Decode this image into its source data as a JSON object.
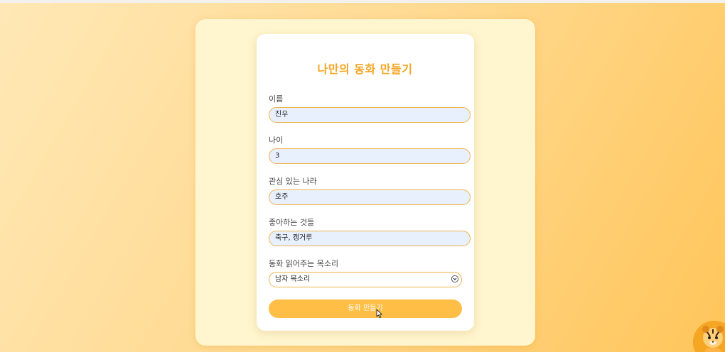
{
  "form": {
    "title": "나만의 동화 만들기",
    "name_label": "이름",
    "name_value": "진우",
    "age_label": "나이",
    "age_value": "3",
    "country_label": "관심 있는 나라",
    "country_value": "호주",
    "likes_label": "좋아하는 것들",
    "likes_value": "축구, 캥거루",
    "voice_label": "동화 읽어주는 목소리",
    "voice_selected": "남자 목소리",
    "submit_label": "동화 만들기"
  },
  "icons": {
    "dropdown": "chevron-down-icon",
    "pointer": "cursor-icon",
    "mascot": "tiger-mascot-icon"
  },
  "colors": {
    "accent": "#f5a623",
    "button": "#ffbf47",
    "field_border": "#f0b24a",
    "field_fill": "#e8f0fe",
    "panel": "#fff5cf"
  }
}
